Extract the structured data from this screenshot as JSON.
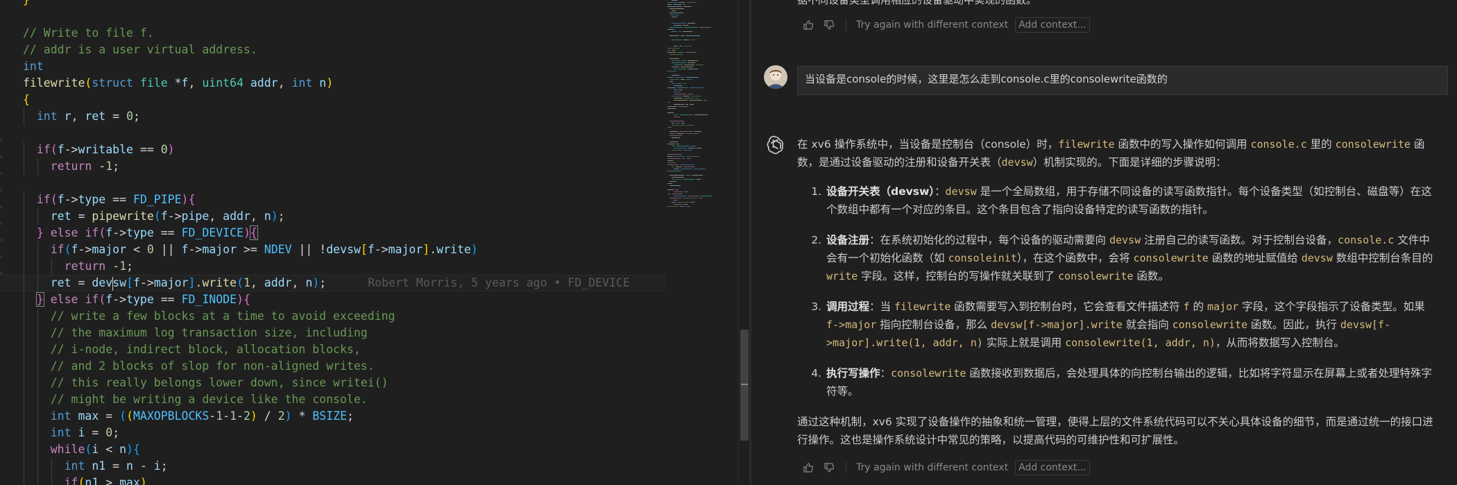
{
  "editor": {
    "blame_text": "Robert Morris, 5 years ago • FD_DEVICE",
    "lines": [
      [
        [
          "t-br1",
          "}"
        ]
      ],
      [],
      [
        [
          "t-com",
          "// Write to file f."
        ]
      ],
      [
        [
          "t-com",
          "// addr is a user virtual address."
        ]
      ],
      [
        [
          "t-kw",
          "int"
        ]
      ],
      [
        [
          "t-fn",
          "filewrite"
        ],
        [
          "t-br1",
          "("
        ],
        [
          "t-kw",
          "struct"
        ],
        [
          "t-p",
          " "
        ],
        [
          "t-type",
          "file"
        ],
        [
          "t-p",
          " *"
        ],
        [
          "t-var",
          "f"
        ],
        [
          "t-p",
          ", "
        ],
        [
          "t-type",
          "uint64"
        ],
        [
          "t-p",
          " "
        ],
        [
          "t-var",
          "addr"
        ],
        [
          "t-p",
          ", "
        ],
        [
          "t-kw",
          "int"
        ],
        [
          "t-p",
          " "
        ],
        [
          "t-var",
          "n"
        ],
        [
          "t-br1",
          ")"
        ]
      ],
      [
        [
          "t-br1",
          "{"
        ]
      ],
      [
        [
          "t-p",
          "  "
        ],
        [
          "t-kw",
          "int"
        ],
        [
          "t-p",
          " "
        ],
        [
          "t-var",
          "r"
        ],
        [
          "t-p",
          ", "
        ],
        [
          "t-var",
          "ret"
        ],
        [
          "t-p",
          " = "
        ],
        [
          "t-num",
          "0"
        ],
        [
          "t-p",
          ";"
        ]
      ],
      [],
      [
        [
          "t-p",
          "  "
        ],
        [
          "t-ctrl",
          "if"
        ],
        [
          "t-br2",
          "("
        ],
        [
          "t-var",
          "f"
        ],
        [
          "t-p",
          "->"
        ],
        [
          "t-var",
          "writable"
        ],
        [
          "t-p",
          " == "
        ],
        [
          "t-num",
          "0"
        ],
        [
          "t-br2",
          ")"
        ]
      ],
      [
        [
          "t-p",
          "    "
        ],
        [
          "t-ctrl",
          "return"
        ],
        [
          "t-p",
          " -"
        ],
        [
          "t-num",
          "1"
        ],
        [
          "t-p",
          ";"
        ]
      ],
      [],
      [
        [
          "t-p",
          "  "
        ],
        [
          "t-ctrl",
          "if"
        ],
        [
          "t-br2",
          "("
        ],
        [
          "t-var",
          "f"
        ],
        [
          "t-p",
          "->"
        ],
        [
          "t-var",
          "type"
        ],
        [
          "t-p",
          " == "
        ],
        [
          "t-const",
          "FD_PIPE"
        ],
        [
          "t-br2",
          ")"
        ],
        [
          "t-br2",
          "{"
        ]
      ],
      [
        [
          "t-p",
          "    "
        ],
        [
          "t-var",
          "ret"
        ],
        [
          "t-p",
          " = "
        ],
        [
          "t-fn",
          "pipewrite"
        ],
        [
          "t-br3",
          "("
        ],
        [
          "t-var",
          "f"
        ],
        [
          "t-p",
          "->"
        ],
        [
          "t-var",
          "pipe"
        ],
        [
          "t-p",
          ", "
        ],
        [
          "t-var",
          "addr"
        ],
        [
          "t-p",
          ", "
        ],
        [
          "t-var",
          "n"
        ],
        [
          "t-br3",
          ")"
        ],
        [
          "t-p",
          ";"
        ]
      ],
      [
        [
          "t-p",
          "  "
        ],
        [
          "t-br2",
          "}"
        ],
        [
          "t-p",
          " "
        ],
        [
          "t-ctrl",
          "else"
        ],
        [
          "t-p",
          " "
        ],
        [
          "t-ctrl",
          "if"
        ],
        [
          "t-br2",
          "("
        ],
        [
          "t-var",
          "f"
        ],
        [
          "t-p",
          "->"
        ],
        [
          "t-var",
          "type"
        ],
        [
          "t-p",
          " == "
        ],
        [
          "t-const",
          "FD_DEVICE"
        ],
        [
          "t-br2",
          ")"
        ],
        [
          "t-br2 bracket-hl",
          "{"
        ]
      ],
      [
        [
          "t-p",
          "    "
        ],
        [
          "t-ctrl",
          "if"
        ],
        [
          "t-br3",
          "("
        ],
        [
          "t-var",
          "f"
        ],
        [
          "t-p",
          "->"
        ],
        [
          "t-var",
          "major"
        ],
        [
          "t-p",
          " < "
        ],
        [
          "t-num",
          "0"
        ],
        [
          "t-p",
          " || "
        ],
        [
          "t-var",
          "f"
        ],
        [
          "t-p",
          "->"
        ],
        [
          "t-var",
          "major"
        ],
        [
          "t-p",
          " >= "
        ],
        [
          "t-const",
          "NDEV"
        ],
        [
          "t-p",
          " || !"
        ],
        [
          "t-var",
          "devsw"
        ],
        [
          "t-br1",
          "["
        ],
        [
          "t-var",
          "f"
        ],
        [
          "t-p",
          "->"
        ],
        [
          "t-var",
          "major"
        ],
        [
          "t-br1",
          "]"
        ],
        [
          "t-p",
          "."
        ],
        [
          "t-var",
          "write"
        ],
        [
          "t-br3",
          ")"
        ]
      ],
      [
        [
          "t-p",
          "      "
        ],
        [
          "t-ctrl",
          "return"
        ],
        [
          "t-p",
          " -"
        ],
        [
          "t-num",
          "1"
        ],
        [
          "t-p",
          ";"
        ]
      ],
      [
        [
          "t-p",
          "    "
        ],
        [
          "t-var",
          "ret"
        ],
        [
          "t-p",
          " = "
        ],
        [
          "t-var",
          "dev"
        ],
        [
          "cursor",
          ""
        ],
        [
          "t-var",
          "sw"
        ],
        [
          "t-br3",
          "["
        ],
        [
          "t-var",
          "f"
        ],
        [
          "t-p",
          "->"
        ],
        [
          "t-var",
          "major"
        ],
        [
          "t-br3",
          "]"
        ],
        [
          "t-p",
          "."
        ],
        [
          "t-fn",
          "write"
        ],
        [
          "t-br3",
          "("
        ],
        [
          "t-num",
          "1"
        ],
        [
          "t-p",
          ", "
        ],
        [
          "t-var",
          "addr"
        ],
        [
          "t-p",
          ", "
        ],
        [
          "t-var",
          "n"
        ],
        [
          "t-br3",
          ")"
        ],
        [
          "t-p",
          ";"
        ],
        [
          "blame",
          ""
        ]
      ],
      [
        [
          "t-p",
          "  "
        ],
        [
          "t-br2 bracket-hl",
          "}"
        ],
        [
          "t-p",
          " "
        ],
        [
          "t-ctrl",
          "else"
        ],
        [
          "t-p",
          " "
        ],
        [
          "t-ctrl",
          "if"
        ],
        [
          "t-br2",
          "("
        ],
        [
          "t-var",
          "f"
        ],
        [
          "t-p",
          "->"
        ],
        [
          "t-var",
          "type"
        ],
        [
          "t-p",
          " == "
        ],
        [
          "t-const",
          "FD_INODE"
        ],
        [
          "t-br2",
          ")"
        ],
        [
          "t-br2",
          "{"
        ]
      ],
      [
        [
          "t-p",
          "    "
        ],
        [
          "t-com",
          "// write a few blocks at a time to avoid exceeding"
        ]
      ],
      [
        [
          "t-p",
          "    "
        ],
        [
          "t-com",
          "// the maximum log transaction size, including"
        ]
      ],
      [
        [
          "t-p",
          "    "
        ],
        [
          "t-com",
          "// i-node, indirect block, allocation blocks,"
        ]
      ],
      [
        [
          "t-p",
          "    "
        ],
        [
          "t-com",
          "// and 2 blocks of slop for non-aligned writes."
        ]
      ],
      [
        [
          "t-p",
          "    "
        ],
        [
          "t-com",
          "// this really belongs lower down, since writei()"
        ]
      ],
      [
        [
          "t-p",
          "    "
        ],
        [
          "t-com",
          "// might be writing a device like the console."
        ]
      ],
      [
        [
          "t-p",
          "    "
        ],
        [
          "t-kw",
          "int"
        ],
        [
          "t-p",
          " "
        ],
        [
          "t-var",
          "max"
        ],
        [
          "t-p",
          " = "
        ],
        [
          "t-br3",
          "("
        ],
        [
          "t-br1",
          "("
        ],
        [
          "t-const",
          "MAXOPBLOCKS"
        ],
        [
          "t-p",
          "-"
        ],
        [
          "t-num",
          "1"
        ],
        [
          "t-p",
          "-"
        ],
        [
          "t-num",
          "1"
        ],
        [
          "t-p",
          "-"
        ],
        [
          "t-num",
          "2"
        ],
        [
          "t-br1",
          ")"
        ],
        [
          "t-p",
          " / "
        ],
        [
          "t-num",
          "2"
        ],
        [
          "t-br3",
          ")"
        ],
        [
          "t-p",
          " * "
        ],
        [
          "t-const",
          "BSIZE"
        ],
        [
          "t-p",
          ";"
        ]
      ],
      [
        [
          "t-p",
          "    "
        ],
        [
          "t-kw",
          "int"
        ],
        [
          "t-p",
          " "
        ],
        [
          "t-var",
          "i"
        ],
        [
          "t-p",
          " = "
        ],
        [
          "t-num",
          "0"
        ],
        [
          "t-p",
          ";"
        ]
      ],
      [
        [
          "t-p",
          "    "
        ],
        [
          "t-ctrl",
          "while"
        ],
        [
          "t-br3",
          "("
        ],
        [
          "t-var",
          "i"
        ],
        [
          "t-p",
          " < "
        ],
        [
          "t-var",
          "n"
        ],
        [
          "t-br3",
          ")"
        ],
        [
          "t-br3",
          "{"
        ]
      ],
      [
        [
          "t-p",
          "      "
        ],
        [
          "t-kw",
          "int"
        ],
        [
          "t-p",
          " "
        ],
        [
          "t-var",
          "n1"
        ],
        [
          "t-p",
          " = "
        ],
        [
          "t-var",
          "n"
        ],
        [
          "t-p",
          " - "
        ],
        [
          "t-var",
          "i"
        ],
        [
          "t-p",
          ";"
        ]
      ],
      [
        [
          "t-p",
          "      "
        ],
        [
          "t-ctrl",
          "if"
        ],
        [
          "t-br1",
          "("
        ],
        [
          "t-var",
          "n1"
        ],
        [
          "t-p",
          " > "
        ],
        [
          "t-var",
          "max"
        ],
        [
          "t-br1",
          ")"
        ]
      ]
    ]
  },
  "chat": {
    "top_cut_text": "据不同设备类型调用相应的设备驱动中实现的函数。",
    "try_again": "Try again with different context",
    "add_context": "Add context...",
    "user_question": "当设备是console的时候，这里是怎么走到console.c里的consolewrite函数的",
    "answer_intro": [
      [
        "t",
        "在 xv6 操作系统中，当设备是控制台（console）时，"
      ],
      [
        "c",
        "filewrite"
      ],
      [
        "t",
        " 函数中的写入操作如何调用 "
      ],
      [
        "c",
        "console.c"
      ],
      [
        "t",
        " 里的 "
      ],
      [
        "c",
        "consolewrite"
      ],
      [
        "t",
        " 函数，是通过设备驱动的注册和设备开关表（"
      ],
      [
        "c",
        "devsw"
      ],
      [
        "t",
        "）机制实现的。下面是详细的步骤说明："
      ]
    ],
    "steps": [
      [
        [
          "b",
          "设备开关表（devsw）"
        ],
        [
          "t",
          "："
        ],
        [
          "c",
          "devsw"
        ],
        [
          "t",
          " 是一个全局数组，用于存储不同设备的读写函数指针。每个设备类型（如控制台、磁盘等）在这个数组中都有一个对应的条目。这个条目包含了指向设备特定的读写函数的指针。"
        ]
      ],
      [
        [
          "b",
          "设备注册"
        ],
        [
          "t",
          "：在系统初始化的过程中，每个设备的驱动需要向 "
        ],
        [
          "c",
          "devsw"
        ],
        [
          "t",
          " 注册自己的读写函数。对于控制台设备，"
        ],
        [
          "c",
          "console.c"
        ],
        [
          "t",
          " 文件中会有一个初始化函数（如 "
        ],
        [
          "c",
          "consoleinit"
        ],
        [
          "t",
          "），在这个函数中，会将 "
        ],
        [
          "c",
          "consolewrite"
        ],
        [
          "t",
          " 函数的地址赋值给 "
        ],
        [
          "c",
          "devsw"
        ],
        [
          "t",
          " 数组中控制台条目的 "
        ],
        [
          "c",
          "write"
        ],
        [
          "t",
          " 字段。这样，控制台的写操作就关联到了 "
        ],
        [
          "c",
          "consolewrite"
        ],
        [
          "t",
          " 函数。"
        ]
      ],
      [
        [
          "b",
          "调用过程"
        ],
        [
          "t",
          "：当 "
        ],
        [
          "c",
          "filewrite"
        ],
        [
          "t",
          " 函数需要写入到控制台时，它会查看文件描述符 "
        ],
        [
          "c",
          "f"
        ],
        [
          "t",
          " 的 "
        ],
        [
          "c",
          "major"
        ],
        [
          "t",
          " 字段，这个字段指示了设备类型。如果 "
        ],
        [
          "c",
          "f->major"
        ],
        [
          "t",
          " 指向控制台设备，那么 "
        ],
        [
          "c",
          "devsw[f->major].write"
        ],
        [
          "t",
          " 就会指向 "
        ],
        [
          "c",
          "consolewrite"
        ],
        [
          "t",
          " 函数。因此，执行 "
        ],
        [
          "c",
          "devsw[f->major].write(1, addr, n)"
        ],
        [
          "t",
          " 实际上就是调用 "
        ],
        [
          "c",
          "consolewrite(1, addr, n)"
        ],
        [
          "t",
          "，从而将数据写入控制台。"
        ]
      ],
      [
        [
          "b",
          "执行写操作"
        ],
        [
          "t",
          "："
        ],
        [
          "c",
          "consolewrite"
        ],
        [
          "t",
          " 函数接收到数据后，会处理具体的向控制台输出的逻辑，比如将字符显示在屏幕上或者处理特殊字符等。"
        ]
      ]
    ],
    "closing": "通过这种机制，xv6 实现了设备操作的抽象和统一管理，使得上层的文件系统代码可以不关心具体设备的细节，而是通过统一的接口进行操作。这也是操作系统设计中常见的策略，以提高代码的可维护性和可扩展性。"
  }
}
